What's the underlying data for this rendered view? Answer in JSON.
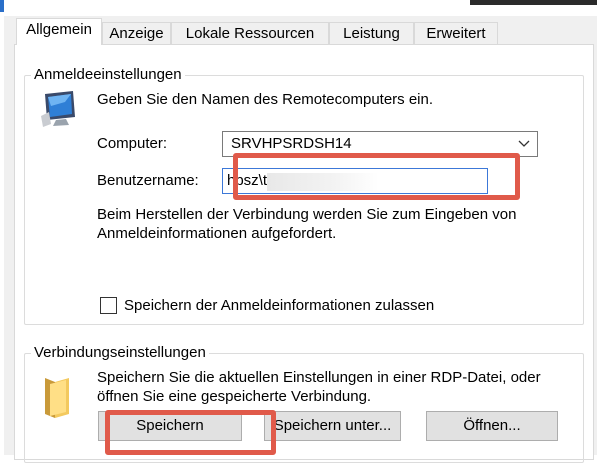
{
  "tabs": [
    {
      "label": "Allgemein"
    },
    {
      "label": "Anzeige"
    },
    {
      "label": "Lokale Ressourcen"
    },
    {
      "label": "Leistung"
    },
    {
      "label": "Erweitert"
    }
  ],
  "logon": {
    "group_title": "Anmeldeeinstellungen",
    "prompt": "Geben Sie den Namen des Remotecomputers ein.",
    "computer_label": "Computer:",
    "computer_value": "SRVHPSRDSH14",
    "username_label": "Benutzername:",
    "username_value": "hpsz\\t",
    "info_text": "Beim Herstellen der Verbindung werden Sie zum Eingeben von Anmeldeinformationen aufgefordert.",
    "save_credentials_label": "Speichern der Anmeldeinformationen zulassen",
    "save_credentials_checked": false
  },
  "connection": {
    "group_title": "Verbindungseinstellungen",
    "info_text": "Speichern Sie die aktuellen Einstellungen in einer RDP-Datei, oder öffnen Sie eine gespeicherte Verbindung.",
    "save_button": "Speichern",
    "save_as_button": "Speichern unter...",
    "open_button": "Öffnen..."
  },
  "highlight_color": "#e05a4a",
  "icons": [
    "computer-monitor-icon",
    "folder-icon",
    "chevron-down-icon"
  ]
}
